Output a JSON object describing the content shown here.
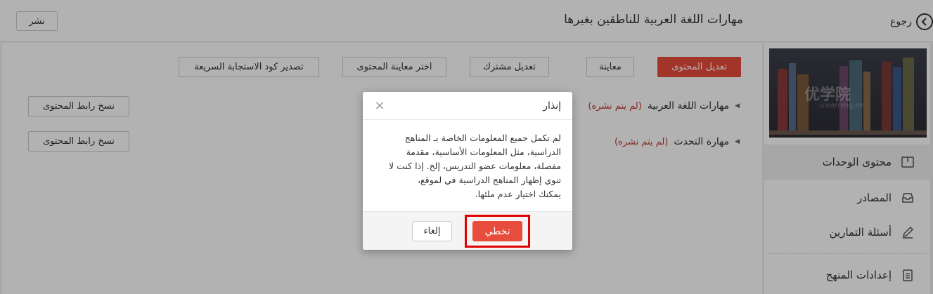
{
  "header": {
    "back_label": "رجوع",
    "page_title": "مهارات اللغة العربية للناطقين بغيرها",
    "publish_label": "نشر"
  },
  "toolbar": {
    "edit_content": "تعديل المحتوى",
    "preview": "معاينة",
    "edit_shared": "تعديل مشترك",
    "choose_preview": "اختر معاينة المحتوى",
    "export_qr": "تصدير كود الاستجابة السريعة"
  },
  "units": [
    {
      "title": "مهارات اللغة العربية",
      "status": "(لم يتم نشره)",
      "copy_link": "نسخ رابط المحتوى"
    },
    {
      "title": "مهارة التحدث",
      "status": "(لم يتم نشره)",
      "copy_link": "نسخ رابط المحتوى"
    }
  ],
  "sidebar": {
    "cover_watermark": "优学院",
    "cover_watermark_sub": "ulearning.cn",
    "items": [
      {
        "label": "محتوى الوحدات",
        "icon": "book-icon",
        "active": true
      },
      {
        "label": "المصادر",
        "icon": "inbox-icon",
        "active": false
      },
      {
        "label": "أسئلة التمارين",
        "icon": "pencil-icon",
        "active": false
      },
      {
        "label": "إعدادات المنهج",
        "icon": "clipboard-icon",
        "active": false
      }
    ]
  },
  "modal": {
    "title": "إنذار",
    "close_glyph": "×",
    "body_lines": [
      "لم تكمل جميع المعلومات الخاصة بـ المناهج",
      "الدراسية، مثل المعلومات الأساسية، مقدمة",
      "مفصلة، معلومات عضو التدريس، إلخ. إذا كنت لا",
      "تنوي إظهار المناهج الدراسية في لموقع،",
      "يمكنك اختيار عدم ملئها."
    ],
    "skip_label": "تخطي",
    "cancel_label": "إلغاء"
  },
  "colors": {
    "accent": "#e84c3d",
    "highlight": "#e00000",
    "status_text": "#c0392b"
  }
}
